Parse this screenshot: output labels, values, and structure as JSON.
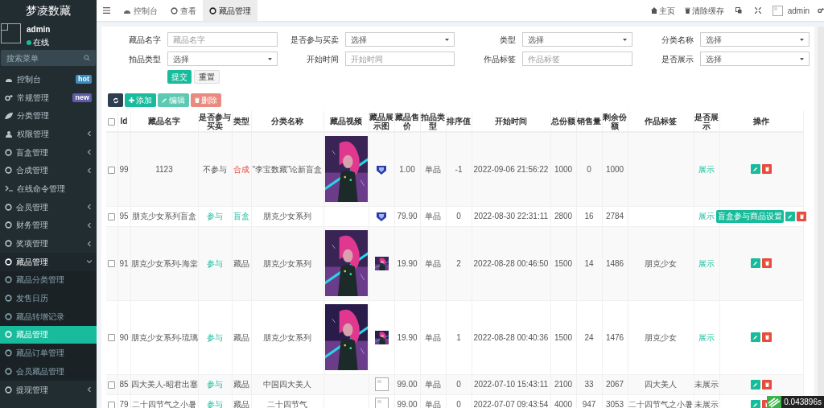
{
  "brand": "梦凌数藏",
  "user": {
    "name": "admin",
    "status": "在线"
  },
  "sidebar": {
    "search_placeholder": "搜索菜单",
    "items": [
      {
        "label": "控制台",
        "badge": {
          "text": "hot",
          "color": "#3c8dbc"
        },
        "selected": false
      },
      {
        "label": "常规管理",
        "badge": {
          "text": "new",
          "color": "#605ca8"
        },
        "selected": false
      },
      {
        "label": "分类管理",
        "selected": false
      },
      {
        "label": "权限管理",
        "expandable": true,
        "expanded": false,
        "selected": false
      },
      {
        "label": "盲盒管理",
        "expandable": true,
        "expanded": false,
        "selected": false
      },
      {
        "label": "合成管理",
        "expandable": true,
        "expanded": false,
        "selected": false
      },
      {
        "label": "在线命令管理",
        "selected": false
      },
      {
        "label": "会员管理",
        "expandable": true,
        "expanded": false,
        "selected": false
      },
      {
        "label": "财务管理",
        "expandable": true,
        "expanded": false,
        "selected": false
      },
      {
        "label": "奖项管理",
        "expandable": true,
        "expanded": false,
        "selected": false
      },
      {
        "label": "藏品管理",
        "expandable": true,
        "expanded": true,
        "selected": false,
        "children": [
          {
            "label": "藏品分类管理",
            "selected": false
          },
          {
            "label": "发售日历",
            "selected": false
          },
          {
            "label": "藏品转增记录",
            "selected": false
          },
          {
            "label": "藏品管理",
            "selected": true
          },
          {
            "label": "藏品订单管理",
            "selected": false
          },
          {
            "label": "会员藏品管理",
            "selected": false
          }
        ]
      },
      {
        "label": "提现管理",
        "expandable": true,
        "expanded": false,
        "selected": false
      }
    ]
  },
  "tabs": [
    {
      "label": "控制台",
      "selected": false
    },
    {
      "label": "查看",
      "selected": false
    },
    {
      "label": "藏品管理",
      "selected": true
    }
  ],
  "header_right": {
    "home": "主页",
    "clear_cache": "清除缓存",
    "user": "admin"
  },
  "filters": [
    {
      "label": "藏品名字",
      "kind": "text",
      "placeholder": "藏品名字"
    },
    {
      "label": "是否参与买卖",
      "kind": "select",
      "value": "选择"
    },
    {
      "label": "类型",
      "kind": "select",
      "value": "选择"
    },
    {
      "label": "分类名称",
      "kind": "select",
      "value": "选择"
    },
    {
      "label": "拍品类型",
      "kind": "select",
      "value": "选择"
    },
    {
      "label": "开始时间",
      "kind": "text",
      "placeholder": "开始时间"
    },
    {
      "label": "作品标签",
      "kind": "text",
      "placeholder": "作品标签"
    },
    {
      "label": "是否展示",
      "kind": "select",
      "value": "选择"
    }
  ],
  "filter_buttons": {
    "submit": "提交",
    "reset": "重置"
  },
  "toolbar": {
    "add": "添加",
    "edit": "编辑",
    "delete": "删除"
  },
  "table": {
    "all_checked": false,
    "columns": [
      "Id",
      "藏品名字",
      "是否参与买卖",
      "类型",
      "分类名称",
      "藏品视频",
      "藏品展示图",
      "藏品售价",
      "拍品类型",
      "排序值",
      "开始时间",
      "总份额",
      "销售量",
      "剩余份额",
      "作品标签",
      "是否展示",
      "操作"
    ],
    "rows": [
      {
        "id": "99",
        "name": "1123",
        "trade": {
          "text": "不参与",
          "kind": "neutral"
        },
        "type": {
          "text": "合成",
          "kind": "danger"
        },
        "category": "“李宝数藏”论新盲盒",
        "video": true,
        "thumb": {
          "kind": "icon"
        },
        "price": "1.00",
        "lot_type": "单品",
        "sort": "-1",
        "start": "2022-09-06 21:56:22",
        "total": "1000",
        "sold": "0",
        "remaining": "1000",
        "show": {
          "text": "展示",
          "kind": "positive"
        },
        "checked": false
      },
      {
        "id": "95",
        "name": "朋克少女系列盲盒",
        "trade": {
          "text": "参与",
          "kind": "positive"
        },
        "type": {
          "text": "盲盒",
          "kind": "positive"
        },
        "category": "朋克少女系列",
        "video": false,
        "thumb": {
          "kind": "icon"
        },
        "price": "79.90",
        "lot_type": "单品",
        "sort": "0",
        "start": "2022-08-30 22:31:11",
        "total": "2800",
        "sold": "16",
        "remaining": "2784",
        "show": {
          "text": "展示",
          "kind": "positive"
        },
        "extra_button": "盲盒参与商品设置",
        "checked": false
      },
      {
        "id": "91",
        "name": "朋克少女系列-海棠",
        "trade": {
          "text": "参与",
          "kind": "positive"
        },
        "type": {
          "text": "藏品",
          "kind": "neutral"
        },
        "category": "朋克少女系列",
        "video": true,
        "price": "19.90",
        "lot_type": "单品",
        "sort": "2",
        "start": "2022-08-28 00:46:50",
        "total": "1500",
        "sold": "14",
        "remaining": "1486",
        "tag": "朋克少女",
        "show": {
          "text": "展示",
          "kind": "positive"
        },
        "checked": false
      },
      {
        "id": "90",
        "name": "朋克少女系列-琉璃",
        "trade": {
          "text": "参与",
          "kind": "positive"
        },
        "type": {
          "text": "藏品",
          "kind": "neutral"
        },
        "category": "朋克少女系列",
        "video": true,
        "price": "19.90",
        "lot_type": "单品",
        "sort": "1",
        "start": "2022-08-28 00:40:36",
        "total": "1500",
        "sold": "24",
        "remaining": "1476",
        "tag": "朋克少女",
        "show": {
          "text": "展示",
          "kind": "positive"
        },
        "checked": false
      },
      {
        "id": "85",
        "name": "四大美人-昭君出塞",
        "trade": {
          "text": "参与",
          "kind": "positive"
        },
        "type": {
          "text": "藏品",
          "kind": "neutral"
        },
        "category": "中国四大美人",
        "video": false,
        "thumb": {
          "kind": "broken"
        },
        "price": "99.00",
        "lot_type": "单品",
        "sort": "0",
        "start": "2022-07-10 15:43:11",
        "total": "2100",
        "sold": "33",
        "remaining": "2067",
        "tag": "四大美人",
        "show": {
          "text": "未展示",
          "kind": "neutral"
        },
        "checked": false
      },
      {
        "id": "79",
        "name": "二十四节气之小暑",
        "trade": {
          "text": "参与",
          "kind": "positive"
        },
        "type": {
          "text": "藏品",
          "kind": "neutral"
        },
        "category": "二十四节气",
        "video": false,
        "thumb": {
          "kind": "broken"
        },
        "price": "99.00",
        "lot_type": "单品",
        "sort": "0",
        "start": "2022-07-07 09:43:54",
        "total": "4000",
        "sold": "947",
        "remaining": "3053",
        "tag": "二十四节气之小暑",
        "show": {
          "text": "未展示",
          "kind": "neutral"
        },
        "checked": false
      }
    ]
  },
  "timer": "0.043896s"
}
